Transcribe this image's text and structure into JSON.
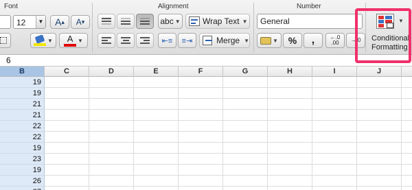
{
  "ribbon": {
    "groups": {
      "font": "Font",
      "alignment": "Alignment",
      "number": "Number"
    },
    "font": {
      "size": "12",
      "grow_label": "A",
      "shrink_label": "A",
      "highlight_color": "#f2e600",
      "font_color": "#e00000",
      "font_color_label": "A"
    },
    "alignment": {
      "orientation_label": "abc",
      "wrap_text": "Wrap Text",
      "merge": "Merge"
    },
    "number": {
      "format": "General",
      "percent": "%",
      "comma": ",",
      "increase_decimals": "←.0\n.00",
      "decrease_decimals": ".0"
    },
    "conditional_formatting": {
      "line1": "Conditional",
      "line2": "Formatting"
    },
    "highlight_color": "#f0306a"
  },
  "formula_bar": {
    "value": "6"
  },
  "grid": {
    "columns": [
      "B",
      "C",
      "D",
      "E",
      "F",
      "G",
      "H",
      "I",
      "J"
    ],
    "selected_column": "B",
    "column_b_values": [
      "19",
      "19",
      "21",
      "21",
      "22",
      "22",
      "19",
      "23",
      "19",
      "26",
      "27"
    ]
  }
}
